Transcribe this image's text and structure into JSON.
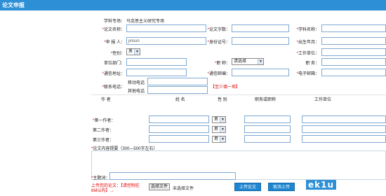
{
  "header": {
    "title": "论文申报"
  },
  "form": {
    "subject_label": "学科专场：",
    "subject_value": "马克思主义研究专场",
    "req_mark": "*",
    "paper_name_label": "论文名称：",
    "word_count_label": "论文字数：",
    "discipline_label": "学科名称：",
    "applicant_label": "申 报 人：",
    "applicant_value": "jinsun",
    "id_label": "身份证号：",
    "birth_label": "出生年月：",
    "gender_label": "性别：",
    "gender_value": "男",
    "work_unit_label": "工作单位：",
    "unit_dept_label": "单位部门：",
    "title_label": "职    称：",
    "title_value": "请选择",
    "position_label": "职    务：",
    "address_label": "通信地址：",
    "postcode_label": "通信邮编：",
    "email_label": "电子邮箱：",
    "phone_label": "联系电话：",
    "mobile_label": "移动电话",
    "other_phone_label": "其他电话",
    "phone_hint": "【至少填一项】",
    "authors_header": {
      "author": "作  者",
      "name": "姓  名",
      "gender": "性  别",
      "job": "职务或职称",
      "unit": "工作单位"
    },
    "authors": [
      {
        "label": "第一作者：",
        "gender": "男"
      },
      {
        "label": "第二作者：",
        "gender": "男"
      },
      {
        "label": "第三作者：",
        "gender": "男"
      }
    ],
    "abstract_label": "论文内容提要（300—500字左右）",
    "keywords_label": "主题词：",
    "upload_label_line1": "上传您的论文：【请控制在",
    "upload_label_line2": "6M以内】→",
    "choose_file_button": "选择文件",
    "no_file_text": "未选择文件",
    "upload_button": "上传论文",
    "cancel_button": "取消上传"
  },
  "watermark": "ek1u"
}
